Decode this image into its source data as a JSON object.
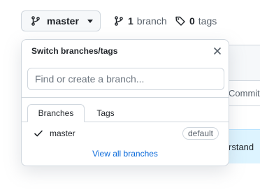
{
  "topbar": {
    "branch_button": {
      "label": "master",
      "icon": "git-branch-icon"
    },
    "branches": {
      "count": "1",
      "label": "branch",
      "icon": "git-branch-icon"
    },
    "tags": {
      "count": "0",
      "label": "tags",
      "icon": "tag-icon"
    }
  },
  "background": {
    "column_header": "Commit",
    "highlight_text": "rstand"
  },
  "popover": {
    "title": "Switch branches/tags",
    "close_icon": "close-icon",
    "search": {
      "placeholder": "Find or create a branch...",
      "value": ""
    },
    "tabs": [
      {
        "label": "Branches",
        "active": true
      },
      {
        "label": "Tags",
        "active": false
      }
    ],
    "branches": [
      {
        "name": "master",
        "selected": true,
        "badge": "default"
      }
    ],
    "view_all": "View all branches"
  },
  "colors": {
    "accent": "#0969da",
    "border": "#d0d7de",
    "button_bg": "#f6f8fa",
    "muted_text": "#57606a",
    "highlight_bg": "#ddf4ff"
  }
}
